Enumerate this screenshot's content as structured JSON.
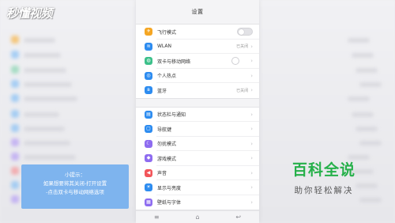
{
  "watermark": {
    "logo_text": "秒懂视频"
  },
  "settings": {
    "title": "设置",
    "groups": [
      [
        {
          "label": "飞行模式",
          "icon": "airplane-icon",
          "color": "#f5a623",
          "control": "toggle"
        },
        {
          "label": "WLAN",
          "icon": "wifi-icon",
          "color": "#2d8cf0",
          "value": "已关闭",
          "control": "chevron"
        },
        {
          "label": "双卡与移动网络",
          "icon": "sim-card-icon",
          "color": "#3cc08a",
          "control": "radio"
        },
        {
          "label": "个人热点",
          "icon": "hotspot-icon",
          "color": "#2d8cf0",
          "control": "chevron"
        },
        {
          "label": "蓝牙",
          "icon": "bluetooth-icon",
          "color": "#2d8cf0",
          "value": "已关闭",
          "control": "chevron"
        }
      ],
      [
        {
          "label": "状态栏与通知",
          "icon": "status-bar-icon",
          "color": "#2d8cf0",
          "control": "chevron"
        },
        {
          "label": "导航键",
          "icon": "navigation-keys-icon",
          "color": "#2d8cf0",
          "control": "chevron"
        },
        {
          "label": "勿扰模式",
          "icon": "do-not-disturb-icon",
          "color": "#8e6cf0",
          "control": "chevron"
        },
        {
          "label": "游戏模式",
          "icon": "game-mode-icon",
          "color": "#8e6cf0",
          "control": "chevron"
        },
        {
          "label": "声音",
          "icon": "sound-icon",
          "color": "#f2555a",
          "control": "chevron"
        },
        {
          "label": "显示与亮度",
          "icon": "display-brightness-icon",
          "color": "#2d8cf0",
          "control": "chevron"
        },
        {
          "label": "壁纸与字体",
          "icon": "wallpaper-font-icon",
          "color": "#8e6cf0",
          "control": "chevron"
        }
      ]
    ],
    "navbar": {
      "menu": "≡",
      "home": "⌂",
      "back": "↩"
    }
  },
  "tip": {
    "heading": "小提示：",
    "line1": "如果想要将其关闭-打开设置",
    "line2": "-点击双卡与移动网络选项"
  },
  "brand": {
    "name": "百科全说",
    "slogan": "助你轻松解决"
  }
}
